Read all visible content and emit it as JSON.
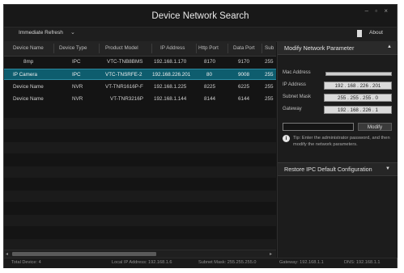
{
  "window": {
    "title": "Device Network Search",
    "controls": "– ▫ ×"
  },
  "toolbar": {
    "refresh_label": "Immediate Refresh",
    "refresh_chevron": "⌄",
    "about_label": "About"
  },
  "table": {
    "columns": [
      "Device Name",
      "Device Type",
      "Product Model",
      "IP Address",
      "Http Port",
      "Data Port",
      "Sub"
    ],
    "rows": [
      {
        "name": "8mp",
        "type": "IPC",
        "model": "VTC-TNB8BMS",
        "ip": "192.168.1.170",
        "http": "8170",
        "data": "9170",
        "sub": "255"
      },
      {
        "name": "IP Camera",
        "type": "IPC",
        "model": "VTC-TNSRFE-2",
        "ip": "192.168.226.201",
        "http": "80",
        "data": "9008",
        "sub": "255"
      },
      {
        "name": "Device Name",
        "type": "NVR",
        "model": "VT-TNR1616P-F",
        "ip": "192.168.1.225",
        "http": "8225",
        "data": "6225",
        "sub": "255"
      },
      {
        "name": "Device Name",
        "type": "NVR",
        "model": "VT-TNR3216P",
        "ip": "192.168.1.144",
        "http": "8144",
        "data": "6144",
        "sub": "255"
      }
    ],
    "selected_row": 1
  },
  "panel": {
    "header": "Modify Network Parameter",
    "mac_label": "Mac Address",
    "ip_label": "IP Address",
    "ip_value": "192 . 168 . 226 . 201",
    "subnet_label": "Subnet Mask",
    "subnet_value": "255 . 255 . 255 . 0",
    "gateway_label": "Gateway",
    "gateway_value": "192 . 168 . 226 . 1",
    "modify_button": "Modify",
    "tip_icon": "i",
    "tip": "Tip: Enter the administrator password, and then modify the network parameters.",
    "restore_header": "Restore IPC Default Configuration"
  },
  "status": {
    "total": "Total Device: 4",
    "local_ip": "Local IP Address: 192.168.1.6",
    "subnet": "Subnet Mask: 255.255.255.0",
    "gateway": "Gateway: 192.168.1.1",
    "dns": "DNS: 192.168.1.1"
  },
  "icons": {
    "about": "document-icon",
    "tip": "info-icon",
    "collapse": "triangle-up-icon",
    "expand": "triangle-down-icon"
  },
  "colors": {
    "selection": "#0e5d6e",
    "background": "#161616",
    "panel": "#1c1c1c"
  }
}
